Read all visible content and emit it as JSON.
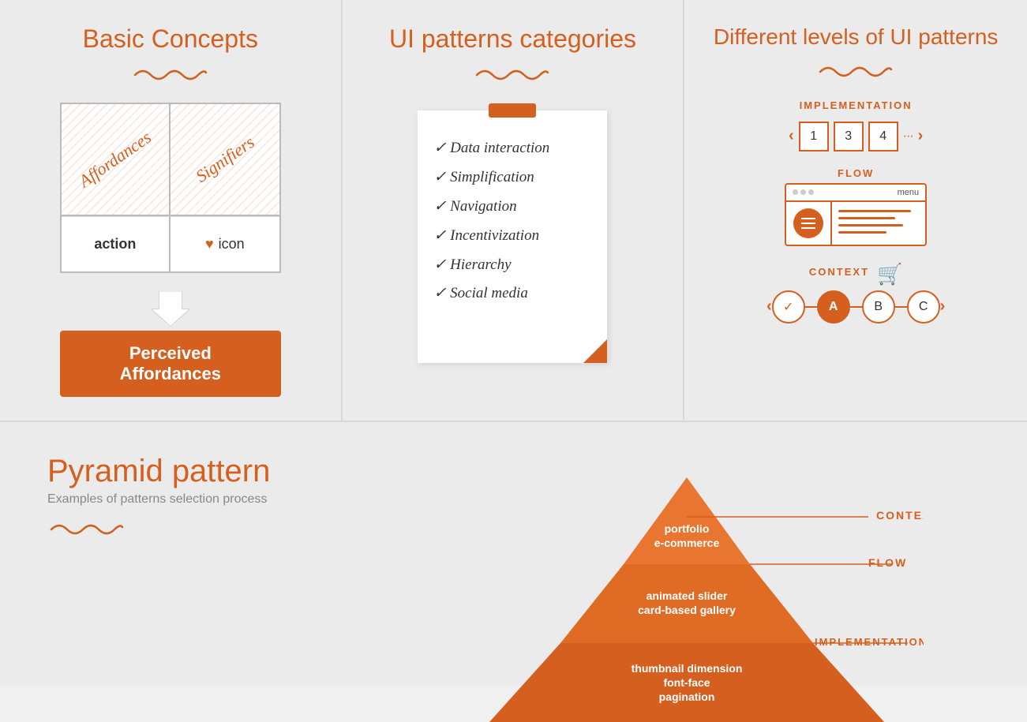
{
  "panel1": {
    "title": "Basic Concepts",
    "squiggle": "〜〜〜〜",
    "cell_affordances": "Affordances",
    "cell_signifiers": "Signifiers",
    "cell_action": "action",
    "cell_icon_heart": "♥",
    "cell_icon_label": "icon",
    "arrow": "↓",
    "perceived_label": "Perceived Affordances"
  },
  "panel2": {
    "title": "UI patterns categories",
    "squiggle": "〜〜〜〜",
    "items": [
      "Data interaction",
      "Simplification",
      "Navigation",
      "Incentivization",
      "Hierarchy",
      "Social media"
    ]
  },
  "panel3": {
    "title": "Different levels of UI patterns",
    "squiggle": "〜〜〜〜",
    "implementation_label": "IMPLEMENTATION",
    "pages": [
      "1",
      "3",
      "4"
    ],
    "dots": "...",
    "flow_label": "FLOW",
    "menu_label": "menu",
    "context_label": "CONTEXT",
    "steps": [
      "✓",
      "A",
      "B",
      "C"
    ]
  },
  "bottom": {
    "title": "Pyramid pattern",
    "subtitle": "Examples of patterns selection process",
    "squiggle": "〜〜〜〜",
    "pyramid": {
      "top_text1": "portfolio",
      "top_text2": "e-commerce",
      "top_label": "CONTEXT",
      "mid_text1": "animated slider",
      "mid_text2": "card-based gallery",
      "mid_label": "FLOW",
      "bot_text1": "thumbnail dimension",
      "bot_text2": "font-face",
      "bot_text3": "pagination",
      "bot_label": "IMPLEMENTATION"
    }
  }
}
